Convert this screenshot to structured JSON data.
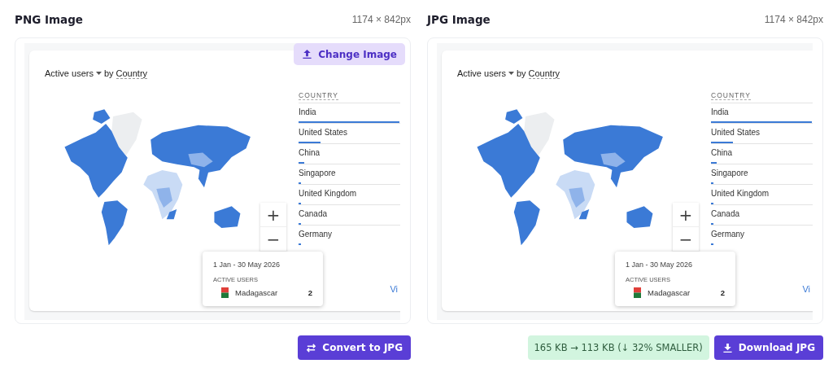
{
  "panels": [
    {
      "title": "PNG Image",
      "dimensions": "1174 × 842px",
      "change_button": {
        "label": "Change Image"
      },
      "image": {
        "metric": "Active users",
        "by": "by",
        "dimension": "Country",
        "table_header": "COUNTRY",
        "rows": [
          {
            "name": "India",
            "level": 1.0
          },
          {
            "name": "United States",
            "level": 0.22
          },
          {
            "name": "China",
            "level": 0.06
          },
          {
            "name": "Singapore",
            "level": 0.02
          },
          {
            "name": "United Kingdom",
            "level": 0.02
          },
          {
            "name": "Canada",
            "level": 0.01
          },
          {
            "name": "Germany",
            "level": 0.01
          }
        ],
        "zoom_in": "+",
        "zoom_out": "−",
        "link": "Vi",
        "tooltip": {
          "date": "1 Jan - 30 May 2026",
          "label": "ACTIVE USERS",
          "country": "Madagascar",
          "value": "2"
        }
      },
      "actions": [
        {
          "kind": "convert",
          "label": "Convert to JPG"
        }
      ]
    },
    {
      "title": "JPG Image",
      "dimensions": "1174 × 842px",
      "image": {
        "metric": "Active users",
        "by": "by",
        "dimension": "Country",
        "table_header": "COUNTRY",
        "rows": [
          {
            "name": "India",
            "level": 1.0
          },
          {
            "name": "United States",
            "level": 0.22
          },
          {
            "name": "China",
            "level": 0.06
          },
          {
            "name": "Singapore",
            "level": 0.02
          },
          {
            "name": "United Kingdom",
            "level": 0.02
          },
          {
            "name": "Canada",
            "level": 0.01
          },
          {
            "name": "Germany",
            "level": 0.01
          }
        ],
        "zoom_in": "+",
        "zoom_out": "−",
        "link": "Vi",
        "tooltip": {
          "date": "1 Jan - 30 May 2026",
          "label": "ACTIVE USERS",
          "country": "Madagascar",
          "value": "2"
        }
      },
      "actions": [
        {
          "kind": "badge",
          "label": "165 KB → 113 KB (↓ 32% SMALLER)"
        },
        {
          "kind": "download",
          "label": "Download JPG"
        }
      ]
    }
  ]
}
